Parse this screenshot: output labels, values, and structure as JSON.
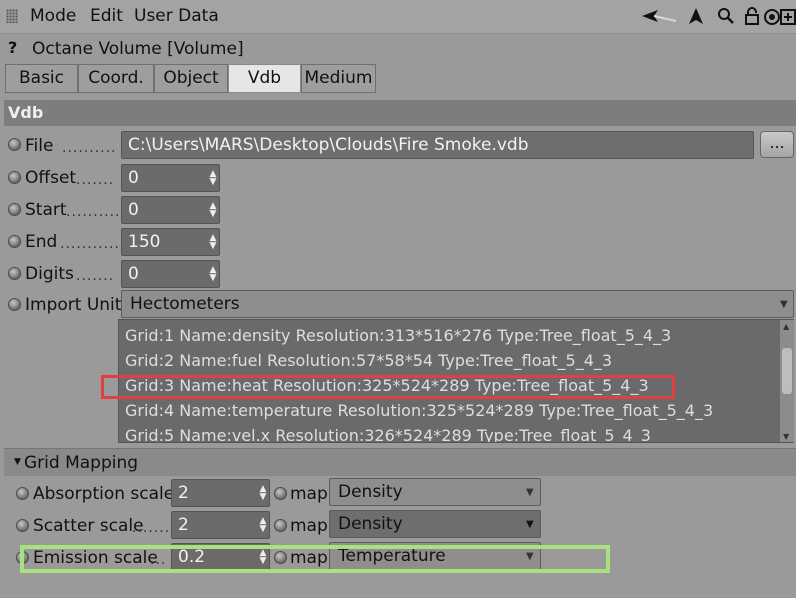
{
  "menubar": {
    "items": [
      "Mode",
      "Edit",
      "User Data"
    ],
    "icons": [
      "back-arrow-icon",
      "cursor-icon",
      "search-icon",
      "lock-icon",
      "target-icon",
      "add-window-icon"
    ]
  },
  "title": {
    "help": "?",
    "text": "Octane Volume [Volume]"
  },
  "tabs": [
    {
      "label": "Basic",
      "active": false
    },
    {
      "label": "Coord.",
      "active": false
    },
    {
      "label": "Object",
      "active": false
    },
    {
      "label": "Vdb",
      "active": true
    },
    {
      "label": "Medium",
      "active": false
    }
  ],
  "section": {
    "title": "Vdb"
  },
  "vdb": {
    "file_label": "File",
    "file_value": "C:\\Users\\MARS\\Desktop\\Clouds\\Fire Smoke.vdb",
    "browse": "...",
    "offset_label": "Offset",
    "offset_value": "0",
    "start_label": "Start",
    "start_value": "0",
    "end_label": "End",
    "end_value": "150",
    "digits_label": "Digits",
    "digits_value": "0",
    "import_unit_label": "Import Unit",
    "import_unit_value": "Hectometers"
  },
  "grids": [
    "Grid:1  Name:density  Resolution:313*516*276  Type:Tree_float_5_4_3",
    "Grid:2  Name:fuel  Resolution:57*58*54  Type:Tree_float_5_4_3",
    "Grid:3  Name:heat  Resolution:325*524*289  Type:Tree_float_5_4_3",
    "Grid:4  Name:temperature  Resolution:325*524*289  Type:Tree_float_5_4_3",
    "Grid:5  Name:vel.x  Resolution:326*524*289  Type:Tree_float_5_4_3"
  ],
  "grid_mapping": {
    "title": "Grid Mapping",
    "absorption_label": "Absorption scale",
    "absorption_value": "2",
    "absorption_map_label": "map",
    "absorption_map_value": "Density",
    "scatter_label": "Scatter scale",
    "scatter_value": "2",
    "scatter_map_label": "map",
    "scatter_map_value": "Density",
    "emission_label": "Emission scale",
    "emission_value": "0.2",
    "emission_map_label": "map",
    "emission_map_value": "Temperature"
  },
  "colors": {
    "highlight_red": "#e04040",
    "highlight_green": "#a8e27e",
    "active_tab": "#e6e6e6"
  }
}
